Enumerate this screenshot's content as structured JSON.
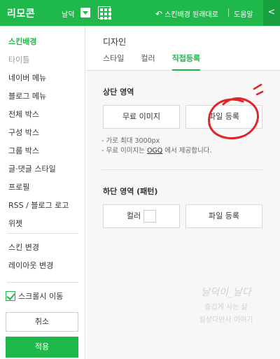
{
  "topbar": {
    "title": "리모콘",
    "tag_label": "날덕",
    "restore_label": "스킨배경 원래대로",
    "help_label": "도움말",
    "collapse_glyph": "<"
  },
  "sidebar": {
    "items": [
      {
        "label": "스킨배경",
        "state": "active"
      },
      {
        "label": "타이틀",
        "state": "dim"
      },
      {
        "label": "네이버 메뉴",
        "state": "normal"
      },
      {
        "label": "블로그 메뉴",
        "state": "normal"
      },
      {
        "label": "전체 박스",
        "state": "normal"
      },
      {
        "label": "구성 박스",
        "state": "normal"
      },
      {
        "label": "그룹 박스",
        "state": "normal"
      },
      {
        "label": "글·댓글 스타일",
        "state": "normal"
      },
      {
        "label": "프로필",
        "state": "normal"
      },
      {
        "label": "RSS / 블로그 로고",
        "state": "normal"
      },
      {
        "label": "위젯",
        "state": "normal"
      }
    ],
    "extra_items": [
      "스킨 변경",
      "레이아웃 변경"
    ],
    "scroll_move_label": "스크롤시 이동",
    "cancel_label": "취소",
    "apply_label": "적용"
  },
  "main": {
    "heading": "디자인",
    "tabs": [
      {
        "label": "스타일",
        "active": false
      },
      {
        "label": "컬러",
        "active": false
      },
      {
        "label": "직접등록",
        "active": true
      }
    ],
    "top_section": {
      "title": "상단 영역",
      "free_image_label": "무료 이미지",
      "file_register_label": "파일 등록",
      "note1": "- 가로 최대 3000px",
      "note2_prefix": "- 무료 이미지는 ",
      "note2_link": "OGQ",
      "note2_suffix": " 에서 제공합니다."
    },
    "bottom_section": {
      "title": "하단 영역 (패턴)",
      "color_label": "컬러",
      "file_register_label": "파일 등록"
    }
  },
  "watermark": {
    "line1": "날덕이_날다",
    "line2": "즐겁게 사는 삶",
    "line3": "일상다반사 이야기"
  },
  "colors": {
    "accent": "#1fb84a",
    "annotation": "#e0242a"
  }
}
